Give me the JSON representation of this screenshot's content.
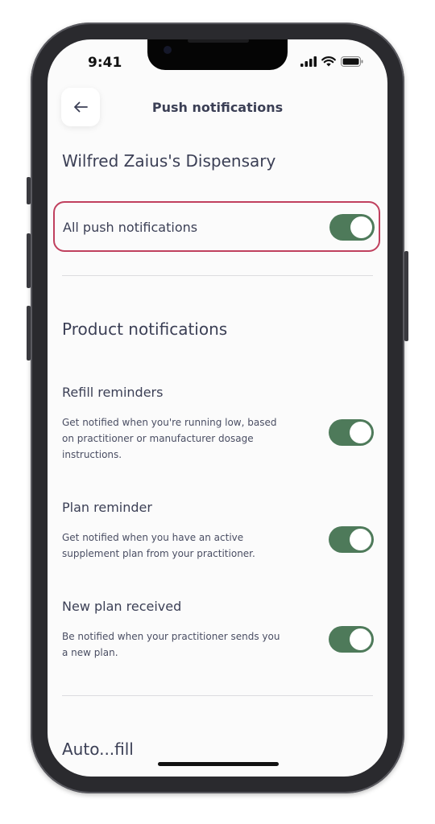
{
  "status": {
    "time": "9:41"
  },
  "header": {
    "title": "Push notifications"
  },
  "dispensary": {
    "name": "Wilfred Zaius's Dispensary"
  },
  "all_push": {
    "label": "All push notifications",
    "enabled": true
  },
  "product": {
    "section_title": "Product notifications",
    "items": [
      {
        "title": "Refill reminders",
        "description": "Get notified when you're running low, based on practitioner or manufacturer dosage instructions.",
        "enabled": true
      },
      {
        "title": "Plan reminder",
        "description": "Get notified when you have an active supplement plan from your practitioner.",
        "enabled": true
      },
      {
        "title": "New plan received",
        "description": "Be notified when your practitioner sends you a new plan.",
        "enabled": true
      }
    ]
  },
  "next_section": {
    "title_partial": "Auto...fill"
  },
  "colors": {
    "toggle_on": "#4e7a5a",
    "highlight_border": "#c0405e",
    "text": "#3b3f55"
  }
}
